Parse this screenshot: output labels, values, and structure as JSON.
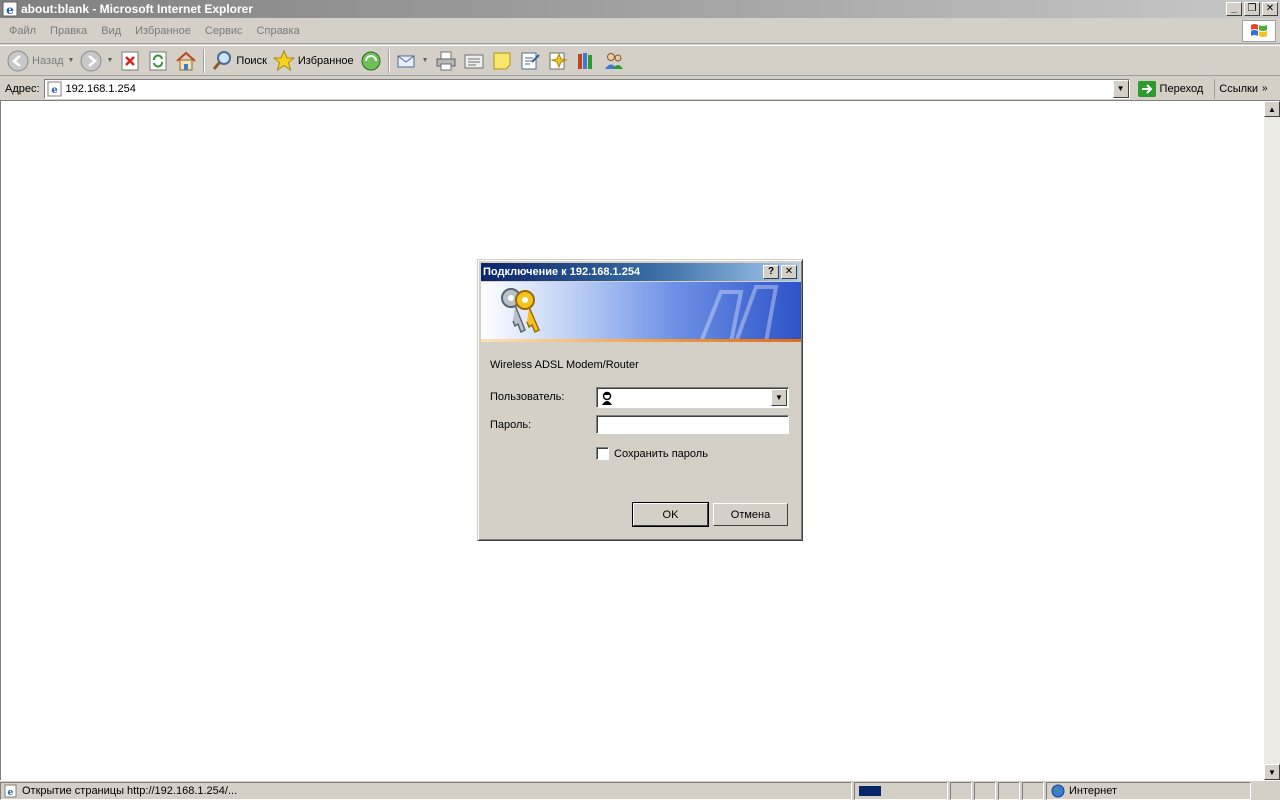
{
  "window": {
    "title": "about:blank - Microsoft Internet Explorer",
    "minimize": "_",
    "restore": "❐",
    "close": "✕"
  },
  "menu": [
    "Файл",
    "Правка",
    "Вид",
    "Избранное",
    "Сервис",
    "Справка"
  ],
  "toolbar": {
    "back_label": "Назад",
    "search_label": "Поиск",
    "favorites_label": "Избранное"
  },
  "address": {
    "label": "Адрес:",
    "value": "192.168.1.254",
    "go_label": "Переход",
    "links_label": "Ссылки"
  },
  "status": {
    "text": "Открытие страницы http://192.168.1.254/...",
    "zone": "Интернет"
  },
  "dialog": {
    "title": "Подключение к 192.168.1.254",
    "help": "?",
    "close": "✕",
    "realm": "Wireless ADSL Modem/Router",
    "user_label": "Пользователь:",
    "user_value": "",
    "password_label": "Пароль:",
    "password_value": "",
    "remember_label": "Сохранить пароль",
    "ok_label": "OK",
    "cancel_label": "Отмена"
  }
}
